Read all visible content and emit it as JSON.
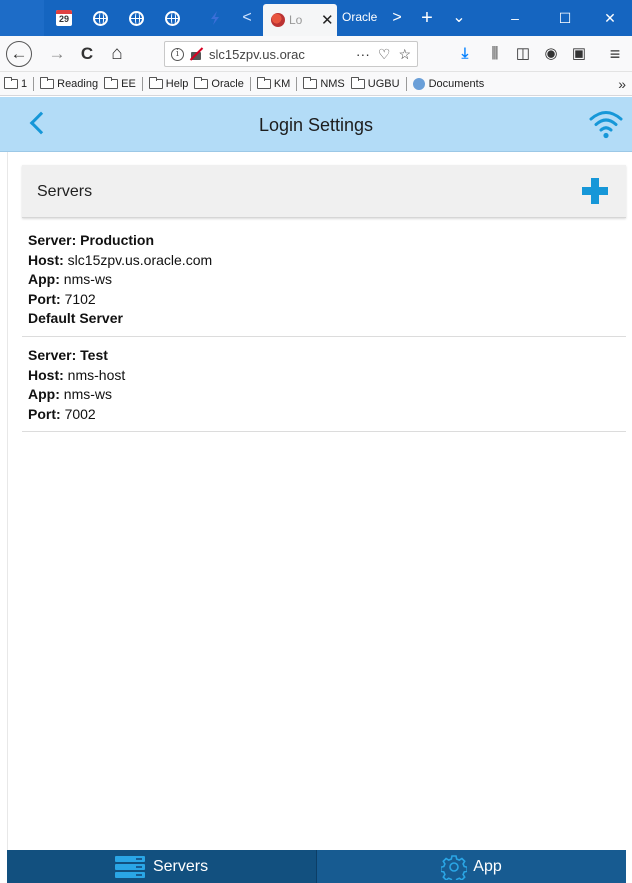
{
  "browser": {
    "tabs": {
      "pinned_calendar_day": "29",
      "active_tab_title": "Lo",
      "second_tab_title": "Oracle U",
      "new_tab": "+",
      "list_tabs": "⌄",
      "scroll_left": "<",
      "scroll_right": ">",
      "close": "✕"
    },
    "window_controls": {
      "minimize": "–",
      "maximize": "☐",
      "close": "✕"
    },
    "nav": {
      "back": "←",
      "forward": "→",
      "reload": "C",
      "home": "⌂",
      "url": "slc15zpv.us.orac",
      "info": "i",
      "page_actions": "···",
      "pocket": "♡",
      "bookmark_star": "☆",
      "download": "⤓",
      "library": "⫼",
      "sidebar": "◫",
      "account": "◉",
      "extension": "▣",
      "menu": "≡"
    },
    "bookmarks": [
      "1",
      "Reading",
      "EE",
      "Help",
      "Oracle",
      "KM",
      "NMS",
      "UGBU"
    ],
    "bookmark_documents": "Documents",
    "bookmark_more": "»"
  },
  "app": {
    "title": "Login Settings",
    "servers_label": "Servers",
    "servers": [
      {
        "name_label": "Server:",
        "name": "Production",
        "host_label": "Host:",
        "host": "slc15zpv.us.oracle.com",
        "app_label": "App:",
        "app": "nms-ws",
        "port_label": "Port:",
        "port": "7102",
        "default": "Default Server"
      },
      {
        "name_label": "Server:",
        "name": "Test",
        "host_label": "Host:",
        "host": "nms-host",
        "app_label": "App:",
        "app": "nms-ws",
        "port_label": "Port:",
        "port": "7002"
      }
    ],
    "bottom_tabs": {
      "servers": "Servers",
      "app": "App"
    },
    "colors": {
      "accent": "#1697d8",
      "header_bg": "#b3dcf7",
      "bottom_bar": "#175b91",
      "browser_chrome": "#1565c0"
    }
  }
}
